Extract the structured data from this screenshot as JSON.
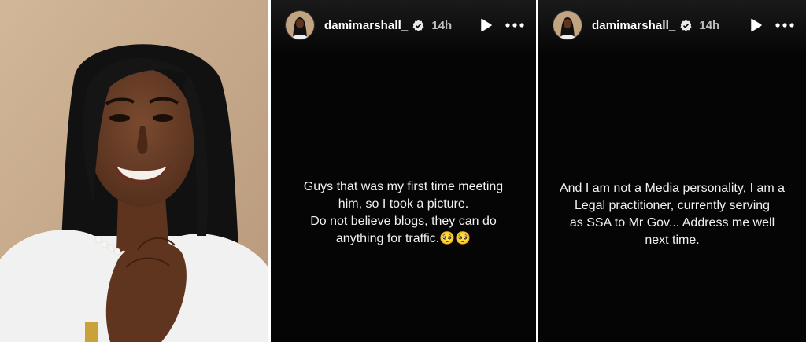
{
  "photo": {
    "alt": "Smiling woman in white top with pearl necklace"
  },
  "stories": [
    {
      "username": "damimarshall_",
      "time": "14h",
      "lines": [
        "Guys that was my first time meeting",
        "him, so I took a  picture.",
        "Do not believe blogs, they can do",
        "anything for traffic.🥺🥺"
      ]
    },
    {
      "username": "damimarshall_",
      "time": "14h",
      "lines": [
        "And I am not a Media personality, I am a",
        "Legal practitioner, currently serving",
        "as SSA to Mr Gov... Address me well",
        "next time."
      ]
    }
  ],
  "icons": {
    "verified": "verified-badge-icon",
    "play": "play-icon",
    "more": "more-options-icon"
  },
  "colors": {
    "story_bg": "#050505",
    "text": "#f2f2f2",
    "muted": "#bdbdbd",
    "photo_bg": "#c8ab8c"
  }
}
